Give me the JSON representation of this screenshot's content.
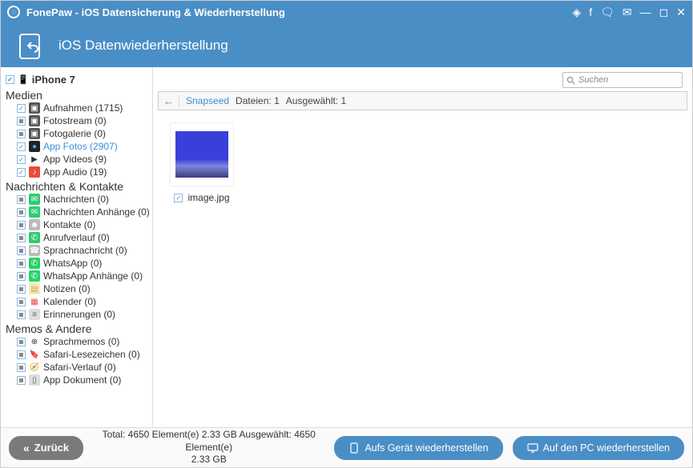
{
  "titlebar": {
    "title": "FonePaw - iOS Datensicherung & Wiederherstellung"
  },
  "header": {
    "title": "iOS Datenwiederherstellung"
  },
  "device": {
    "name": "iPhone 7"
  },
  "sections": {
    "medien": {
      "title": "Medien",
      "items": [
        {
          "label": "Aufnahmen (1715)",
          "chk": "checked",
          "icon_bg": "#555",
          "icon_fg": "#fff",
          "glyph": "▣"
        },
        {
          "label": "Fotostream (0)",
          "chk": "square",
          "icon_bg": "#555",
          "icon_fg": "#fff",
          "glyph": "▣"
        },
        {
          "label": "Fotogalerie (0)",
          "chk": "square",
          "icon_bg": "#555",
          "icon_fg": "#fff",
          "glyph": "▣"
        },
        {
          "label": "App Fotos (2907)",
          "chk": "checked",
          "icon_bg": "#222",
          "icon_fg": "#4aa3ff",
          "glyph": "●",
          "active": true
        },
        {
          "label": "App Videos (9)",
          "chk": "checked",
          "icon_bg": "#fff",
          "icon_fg": "#333",
          "glyph": "▶"
        },
        {
          "label": "App Audio (19)",
          "chk": "checked",
          "icon_bg": "#e74c3c",
          "icon_fg": "#fff",
          "glyph": "♪"
        }
      ]
    },
    "nachrichten": {
      "title": "Nachrichten & Kontakte",
      "items": [
        {
          "label": "Nachrichten (0)",
          "chk": "square",
          "icon_bg": "#2ecc71",
          "icon_fg": "#fff",
          "glyph": "✉"
        },
        {
          "label": "Nachrichten Anhänge (0)",
          "chk": "square",
          "icon_bg": "#2ecc71",
          "icon_fg": "#fff",
          "glyph": "✉"
        },
        {
          "label": "Kontakte (0)",
          "chk": "square",
          "icon_bg": "#bbb",
          "icon_fg": "#fff",
          "glyph": "☻"
        },
        {
          "label": "Anrufverlauf (0)",
          "chk": "square",
          "icon_bg": "#2ecc71",
          "icon_fg": "#fff",
          "glyph": "✆"
        },
        {
          "label": "Sprachnachricht (0)",
          "chk": "square",
          "icon_bg": "#bbb",
          "icon_fg": "#fff",
          "glyph": "☎"
        },
        {
          "label": "WhatsApp (0)",
          "chk": "square",
          "icon_bg": "#25d366",
          "icon_fg": "#fff",
          "glyph": "✆"
        },
        {
          "label": "WhatsApp Anhänge (0)",
          "chk": "square",
          "icon_bg": "#25d366",
          "icon_fg": "#fff",
          "glyph": "✆"
        },
        {
          "label": "Notizen (0)",
          "chk": "square",
          "icon_bg": "#f9e9b9",
          "icon_fg": "#c7a84b",
          "glyph": "▤"
        },
        {
          "label": "Kalender (0)",
          "chk": "square",
          "icon_bg": "#fff",
          "icon_fg": "#e74c3c",
          "glyph": "▦"
        },
        {
          "label": "Erinnerungen (0)",
          "chk": "square",
          "icon_bg": "#ddd",
          "icon_fg": "#666",
          "glyph": "≡"
        }
      ]
    },
    "memos": {
      "title": "Memos & Andere",
      "items": [
        {
          "label": "Sprachmemos (0)",
          "chk": "square",
          "icon_bg": "#fff",
          "icon_fg": "#333",
          "glyph": "⊕"
        },
        {
          "label": "Safari-Lesezeichen (0)",
          "chk": "square",
          "icon_bg": "#fff",
          "icon_fg": "#e74c3c",
          "glyph": "🔖"
        },
        {
          "label": "Safari-Verlauf (0)",
          "chk": "square",
          "icon_bg": "#fff",
          "icon_fg": "#3a8fd8",
          "glyph": "🧭"
        },
        {
          "label": "App Dokument (0)",
          "chk": "square",
          "icon_bg": "#ddd",
          "icon_fg": "#666",
          "glyph": "▯"
        }
      ]
    }
  },
  "search": {
    "placeholder": "Suchen"
  },
  "breadcrumb": {
    "link": "Snapseed",
    "files_label": "Dateien:",
    "files_count": "1",
    "selected_label": "Ausgewählt:",
    "selected_count": "1"
  },
  "thumb": {
    "filename": "image.jpg"
  },
  "footer": {
    "back": "Zurück",
    "stats_line1": "Total: 4650 Element(e) 2.33 GB   Ausgewählt: 4650 Element(e)",
    "stats_line2": "2.33 GB",
    "restore_device": "Aufs Gerät wiederherstellen",
    "restore_pc": "Auf den PC wiederherstellen"
  }
}
